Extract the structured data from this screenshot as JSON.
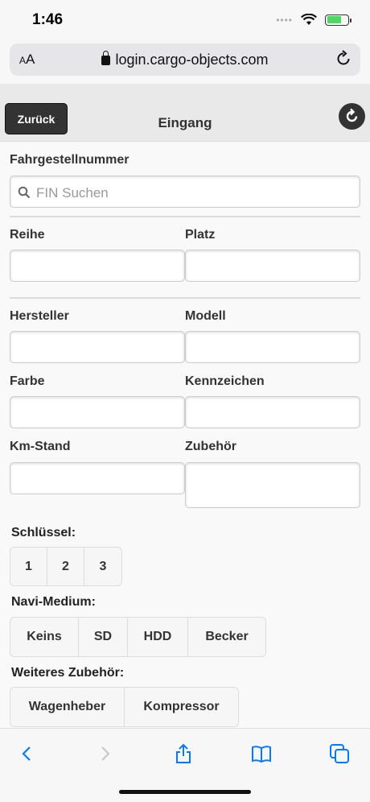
{
  "status": {
    "time": "1:46"
  },
  "browser": {
    "text_size": "AA",
    "url": "login.cargo-objects.com"
  },
  "header": {
    "back_label": "Zurück",
    "title": "Eingang"
  },
  "form": {
    "fin": {
      "label": "Fahrgestellnummer",
      "placeholder": "FIN Suchen",
      "value": ""
    },
    "reihe": {
      "label": "Reihe",
      "value": ""
    },
    "platz": {
      "label": "Platz",
      "value": ""
    },
    "hersteller": {
      "label": "Hersteller",
      "value": ""
    },
    "modell": {
      "label": "Modell",
      "value": ""
    },
    "farbe": {
      "label": "Farbe",
      "value": ""
    },
    "kennzeichen": {
      "label": "Kennzeichen",
      "value": ""
    },
    "km_stand": {
      "label": "Km-Stand",
      "value": ""
    },
    "zubehoer": {
      "label": "Zubehör",
      "value": ""
    },
    "schluessel": {
      "label": "Schlüssel:",
      "options": [
        "1",
        "2",
        "3"
      ]
    },
    "navi": {
      "label": "Navi-Medium:",
      "options": [
        "Keins",
        "SD",
        "HDD",
        "Becker"
      ]
    },
    "weiteres": {
      "label": "Weiteres Zubehör:",
      "options": [
        "Wagenheber",
        "Kompressor"
      ]
    }
  },
  "toolbar": {
    "items": [
      "back-icon",
      "forward-icon",
      "share-icon",
      "bookmarks-icon",
      "tabs-icon"
    ]
  },
  "colors": {
    "accent": "#007aff",
    "header_button": "#333333",
    "battery": "#4cd964"
  }
}
